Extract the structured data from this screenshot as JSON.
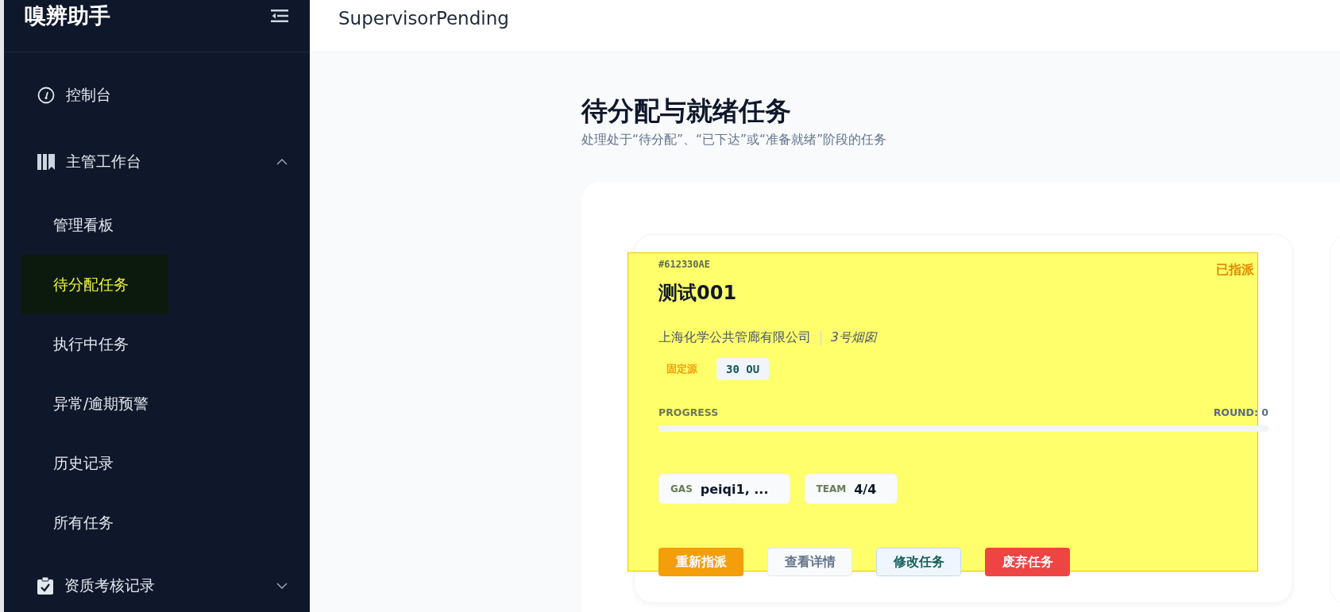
{
  "app": {
    "title": "嗅辨助手"
  },
  "sidebar": {
    "items": [
      {
        "label": "控制台"
      },
      {
        "label": "主管工作台",
        "expanded": true,
        "children": [
          {
            "label": "管理看板",
            "selected": false
          },
          {
            "label": "待分配任务",
            "selected": true
          },
          {
            "label": "执行中任务",
            "selected": false
          },
          {
            "label": "异常/逾期预警",
            "selected": false
          },
          {
            "label": "历史记录",
            "selected": false
          },
          {
            "label": "所有任务",
            "selected": false
          }
        ]
      },
      {
        "label": "资质考核记录",
        "expanded": false
      }
    ]
  },
  "header": {
    "title": "SupervisorPending"
  },
  "page": {
    "title": "待分配与就绪任务",
    "subtitle": "处理处于“待分配”、“已下达”或“准备就绪”阶段的任务"
  },
  "tasks": [
    {
      "id": "#612330AE",
      "status": "已指派",
      "name": "测试001",
      "company": "上海化学公共管廊有限公司",
      "source": "3号烟囱",
      "source_type": "固定源",
      "concentration": "30 OU",
      "progress_label": "PROGRESS",
      "round": "ROUND: 0",
      "level": 0,
      "gas_label": "GAS",
      "gas": "peiqi1, ...",
      "team_label": "TEAM",
      "team": "4/4",
      "highlighted": true,
      "actions": [
        {
          "label": "重新指派",
          "kind": "warning"
        },
        {
          "label": "查看详情",
          "kind": "default"
        },
        {
          "label": "修改任务",
          "kind": "primary"
        },
        {
          "label": "废弃任务",
          "kind": "danger"
        }
      ]
    }
  ]
}
